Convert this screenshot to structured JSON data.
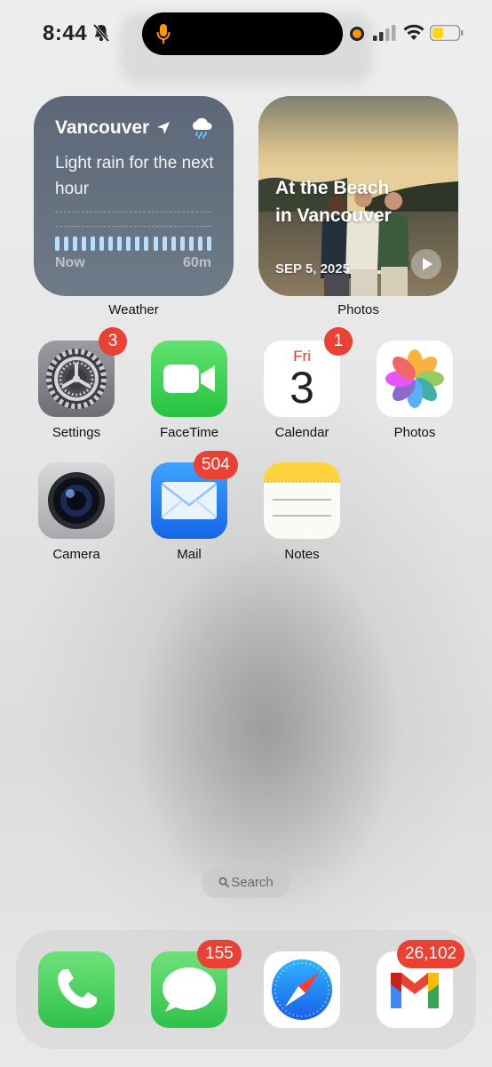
{
  "status_bar": {
    "time": "8:44",
    "icons": [
      "bell-slash-icon",
      "microphone-icon",
      "recording-dot-icon",
      "cellular-signal-icon",
      "wifi-icon",
      "battery-icon"
    ],
    "accent_mic": "#ff9500",
    "battery_color": "#ffd60a"
  },
  "widgets": {
    "weather": {
      "city": "Vancouver",
      "description": "Light rain for the next hour",
      "start_label": "Now",
      "end_label": "60m",
      "precipitation_bars": 18,
      "icons": [
        "location-arrow-icon",
        "rain-cloud-icon"
      ],
      "label": "Weather"
    },
    "photos": {
      "title": "At the Beach in Vancouver",
      "date": "SEP 5, 2025",
      "icons": [
        "play-icon"
      ],
      "label": "Photos"
    }
  },
  "apps": [
    {
      "label": "Settings",
      "badge": "3",
      "icon": "settings-icon"
    },
    {
      "label": "FaceTime",
      "badge": "",
      "icon": "facetime-icon"
    },
    {
      "label": "Calendar",
      "badge": "1",
      "icon": "calendar-icon",
      "weekday": "Fri",
      "day": "3"
    },
    {
      "label": "Photos",
      "badge": "",
      "icon": "photos-icon"
    },
    {
      "label": "Camera",
      "badge": "",
      "icon": "camera-icon"
    },
    {
      "label": "Mail",
      "badge": "504",
      "icon": "mail-icon"
    },
    {
      "label": "Notes",
      "badge": "",
      "icon": "notes-icon"
    }
  ],
  "search": {
    "label": "Search",
    "icon": "search-icon"
  },
  "dock": [
    {
      "app": "Phone",
      "badge": "",
      "icon": "phone-icon"
    },
    {
      "app": "Messages",
      "badge": "155",
      "icon": "messages-icon"
    },
    {
      "app": "Safari",
      "badge": "",
      "icon": "safari-icon"
    },
    {
      "app": "Gmail",
      "badge": "26,102",
      "icon": "gmail-icon"
    }
  ],
  "colors": {
    "badge": "#eb4034",
    "weather_bg": "#5c6877",
    "facetime_green": "#34c759",
    "mail_blue": "#1e7cf2",
    "notes_yellow": "#ffd23f"
  }
}
